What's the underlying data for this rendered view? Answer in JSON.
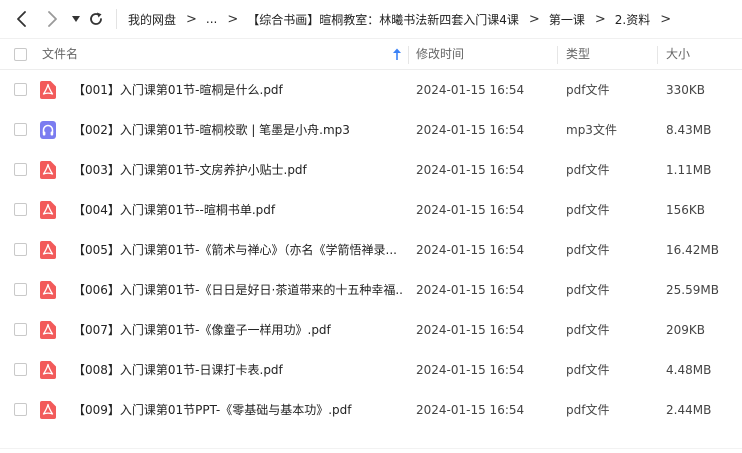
{
  "breadcrumb": {
    "items": [
      "我的网盘",
      "...",
      "【综合书画】暄桐教室：林曦书法新四套入门课4课",
      "第一课",
      "2.资料"
    ],
    "separator": ">"
  },
  "table": {
    "columns": {
      "name": "文件名",
      "time": "修改时间",
      "type": "类型",
      "size": "大小"
    },
    "sort": {
      "column": "name",
      "direction": "ascending"
    },
    "rows": [
      {
        "name": "【001】入门课第01节-暄桐是什么.pdf",
        "time": "2024-01-15 16:54",
        "type": "pdf文件",
        "size": "330KB",
        "icon": "pdf-icon"
      },
      {
        "name": "【002】入门课第01节-暄桐校歌 | 笔墨是小舟.mp3",
        "time": "2024-01-15 16:54",
        "type": "mp3文件",
        "size": "8.43MB",
        "icon": "audio-icon"
      },
      {
        "name": "【003】入门课第01节-文房养护小贴士.pdf",
        "time": "2024-01-15 16:54",
        "type": "pdf文件",
        "size": "1.11MB",
        "icon": "pdf-icon"
      },
      {
        "name": "【004】入门课第01节--暄桐书单.pdf",
        "time": "2024-01-15 16:54",
        "type": "pdf文件",
        "size": "156KB",
        "icon": "pdf-icon"
      },
      {
        "name": "【005】入门课第01节-《箭术与禅心》（亦名《学箭悟禅录...",
        "time": "2024-01-15 16:54",
        "type": "pdf文件",
        "size": "16.42MB",
        "icon": "pdf-icon"
      },
      {
        "name": "【006】入门课第01节-《日日是好日·茶道带来的十五种幸福...",
        "time": "2024-01-15 16:54",
        "type": "pdf文件",
        "size": "25.59MB",
        "icon": "pdf-icon"
      },
      {
        "name": "【007】入门课第01节-《像童子一样用功》.pdf",
        "time": "2024-01-15 16:54",
        "type": "pdf文件",
        "size": "209KB",
        "icon": "pdf-icon"
      },
      {
        "name": "【008】入门课第01节-日课打卡表.pdf",
        "time": "2024-01-15 16:54",
        "type": "pdf文件",
        "size": "4.48MB",
        "icon": "pdf-icon"
      },
      {
        "name": "【009】入门课第01节PPT-《零基础与基本功》.pdf",
        "time": "2024-01-15 16:54",
        "type": "pdf文件",
        "size": "2.44MB",
        "icon": "pdf-icon"
      }
    ]
  },
  "colors": {
    "pdf_icon": "#f25b5b",
    "audio_icon": "#7b7cf0",
    "sort_arrow": "#3b82f6",
    "icon_dark": "#333333",
    "disabled": "#9a9a9a"
  }
}
